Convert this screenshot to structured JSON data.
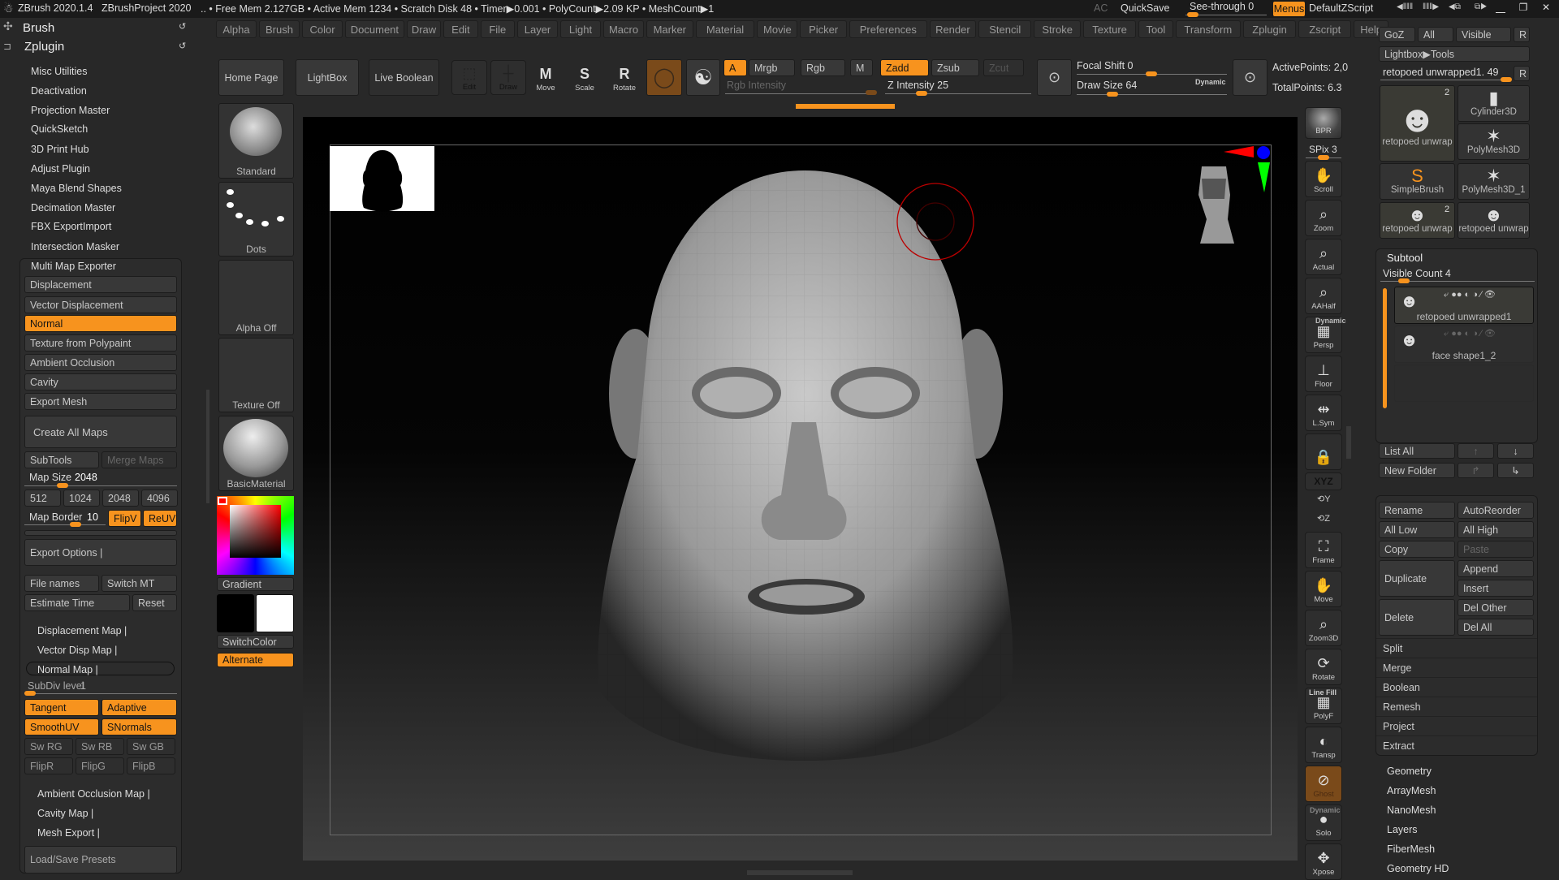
{
  "colors": {
    "accent": "#f7931e",
    "panel": "#282828",
    "button": "#383838",
    "viewport": "#000000"
  },
  "titlebar": {
    "app_icon": "zbrush-figure-icon",
    "app": "ZBrush 2020.1.4",
    "project": "ZBrushProject 2020",
    "stats": ".. • Free Mem 2.127GB • Active Mem 1234 • Scratch Disk 48 •  Timer▶0.001 • PolyCount▶2.09 KP  • MeshCount▶1",
    "ac": "AC",
    "quicksave": "QuickSave",
    "see_through": "See-through  0",
    "menus": "Menus",
    "script": "DefaultZScript",
    "window_buttons": [
      "minimize-icon",
      "restore-icon",
      "close-icon"
    ]
  },
  "menubar": [
    "Alpha",
    "Brush",
    "Color",
    "Document",
    "Draw",
    "Edit",
    "File",
    "Layer",
    "Light",
    "Macro",
    "Marker",
    "Material",
    "Movie",
    "Picker",
    "Preferences",
    "Render",
    "Stencil",
    "Stroke",
    "Texture",
    "Tool",
    "Transform",
    "Zplugin",
    "Zscript",
    "Help"
  ],
  "left": {
    "brush_header": "Brush",
    "zplugin_header": "Zplugin",
    "plugins": [
      "Misc Utilities",
      "Deactivation",
      "Projection Master",
      "QuickSketch",
      "3D Print Hub",
      "Adjust Plugin",
      "Maya Blend Shapes",
      "Decimation Master",
      "FBX ExportImport",
      "Intersection Masker",
      "Multi Map Exporter"
    ],
    "maps": [
      "Displacement",
      "Vector Displacement",
      "Normal",
      "Texture from Polypaint",
      "Ambient Occlusion",
      "Cavity",
      "Export Mesh"
    ],
    "active_map": "Normal",
    "create_all": "Create All Maps",
    "subtools": "SubTools",
    "merge_maps": "Merge Maps",
    "map_size_label": "Map Size",
    "map_size": "2048",
    "map_size_fraction": 0.25,
    "sizes": [
      "512",
      "1024",
      "2048",
      "4096"
    ],
    "map_border_label": "Map Border",
    "map_border": "10",
    "map_border_fraction": 0.5,
    "flipv": "FlipV",
    "reuv": "ReUV",
    "export_options": "Export Options |",
    "file_names": "File names",
    "switch_mt": "Switch MT",
    "estimate_time": "Estimate Time",
    "reset": "Reset",
    "disp_map": "Displacement Map |",
    "vector_disp_map": "Vector Disp Map |",
    "normal_map": "Normal Map |",
    "subdiv_label": "SubDiv level",
    "subdiv": "1",
    "tangent": "Tangent",
    "adaptive": "Adaptive",
    "smoothuv": "SmoothUV",
    "snormals": "SNormals",
    "swaps": [
      "Sw RG",
      "Sw RB",
      "Sw GB"
    ],
    "flips": [
      "FlipR",
      "FlipG",
      "FlipB"
    ],
    "ao_map": "Ambient Occlusion Map |",
    "cavity_map": "Cavity Map |",
    "mesh_export": "Mesh Export |",
    "presets": "Load/Save Presets"
  },
  "shelf": {
    "brush": "Standard",
    "stroke": "Dots",
    "alpha": "Alpha Off",
    "texture": "Texture Off",
    "material": "BasicMaterial",
    "gradient": "Gradient",
    "switch_color": "SwitchColor",
    "alternate": "Alternate",
    "main_color": "#000000",
    "secondary_color": "#ffffff"
  },
  "toolbar": {
    "home": "Home Page",
    "lightbox": "LightBox",
    "live_boolean": "Live Boolean",
    "edit": "Edit",
    "draw": "Draw",
    "move": "Move",
    "scale": "Scale",
    "rotate": "Rotate",
    "a": "A",
    "mrgb": "Mrgb",
    "rgb": "Rgb",
    "m": "M",
    "zadd": "Zadd",
    "zsub": "Zsub",
    "zcut": "Zcut",
    "rgb_intensity": "Rgb Intensity",
    "z_intensity": "Z Intensity 25",
    "z_intensity_value": 25,
    "focal_shift": "Focal Shift 0",
    "draw_size": "Draw Size 64",
    "dynamic": "Dynamic",
    "active_points": "ActivePoints: 2,0",
    "total_points": "TotalPoints: 6.3"
  },
  "tray": {
    "bpr": "BPR",
    "spix": "SPix 3",
    "buttons": [
      "Scroll",
      "Zoom",
      "Actual",
      "AAHalf",
      "Persp",
      "Floor",
      "L.Sym",
      "",
      "XYZ"
    ],
    "lower": [
      "Frame",
      "Move",
      "Zoom3D",
      "Rotate",
      "PolyF",
      "Transp",
      "Ghost",
      "Solo",
      "Xpose"
    ],
    "persp_tag": "Dynamic",
    "polyf_tag": "Line Fill",
    "solo_tag": "Dynamic"
  },
  "right": {
    "goz": "GoZ",
    "all": "All",
    "visible": "Visible",
    "r": "R",
    "lightbox_tools": "Lightbox▶Tools",
    "current_tool": "retopoed unwrapped1. 49",
    "tools": [
      {
        "name": "retopoed unwrap",
        "badge": "2"
      },
      {
        "name": "Cylinder3D"
      },
      {
        "name": "PolyMesh3D"
      },
      {
        "name": "SimpleBrush"
      },
      {
        "name": "PolyMesh3D_1"
      },
      {
        "name": "retopoed unwrap",
        "badge": "2"
      },
      {
        "name": "retopoed unwrap"
      }
    ],
    "subtool": "Subtool",
    "visible_count": "Visible Count 4",
    "subtools": [
      "retopoed unwrapped1",
      "face shape1_2"
    ],
    "list_all": "List All",
    "new_folder": "New Folder",
    "ops": [
      [
        "Rename",
        "AutoReorder"
      ],
      [
        "All Low",
        "All High"
      ],
      [
        "Copy",
        "Paste"
      ]
    ],
    "duplicate": "Duplicate",
    "append": "Append",
    "insert": "Insert",
    "delete": "Delete",
    "del_other": "Del Other",
    "del_all": "Del All",
    "sections": [
      "Split",
      "Merge",
      "Boolean",
      "Remesh",
      "Project",
      "Extract"
    ],
    "subpalettes": [
      "Geometry",
      "ArrayMesh",
      "NanoMesh",
      "Layers",
      "FiberMesh",
      "Geometry HD"
    ]
  }
}
